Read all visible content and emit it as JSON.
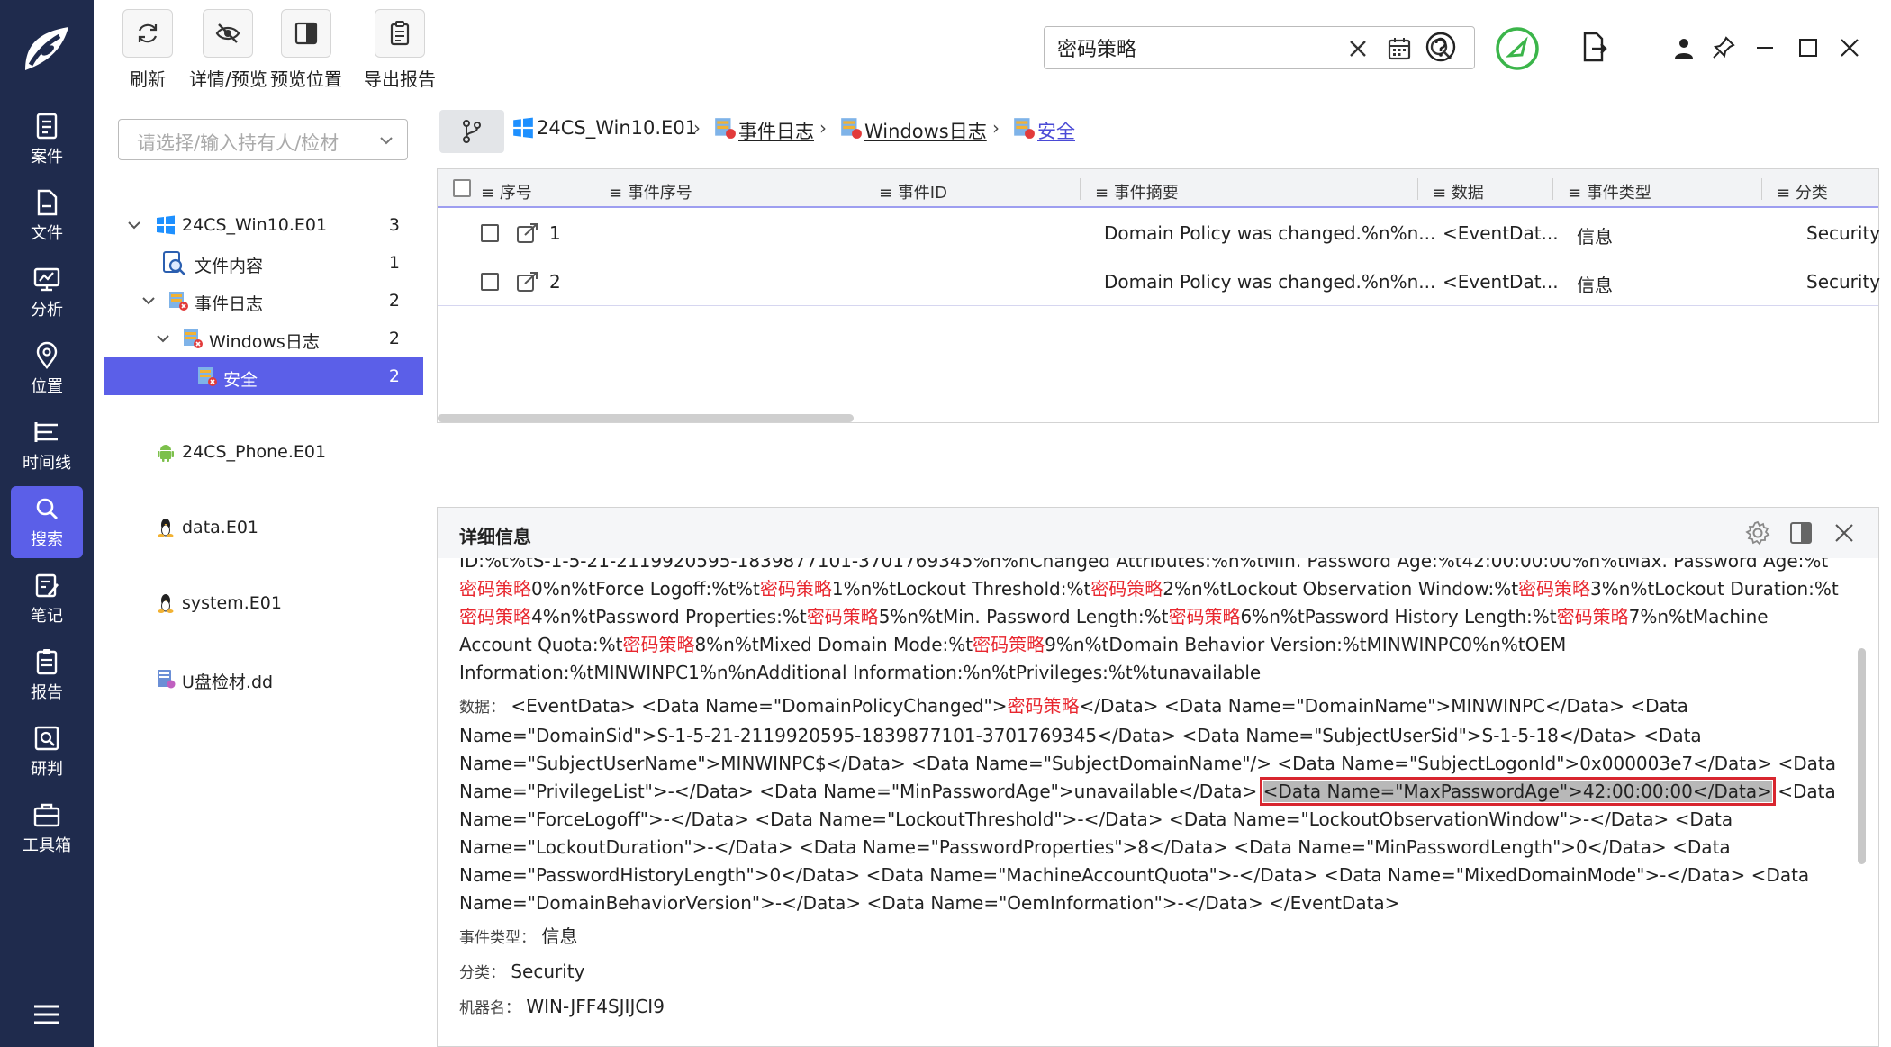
{
  "toolbar": {
    "refresh_label": "刷新",
    "detail_preview_label": "详情/预览",
    "preview_position_label": "预览位置",
    "export_report_label": "导出报告"
  },
  "search": {
    "value": "密码策略"
  },
  "nav": {
    "items": [
      {
        "label": "案件",
        "icon": "case-icon"
      },
      {
        "label": "文件",
        "icon": "file-icon"
      },
      {
        "label": "分析",
        "icon": "analysis-icon"
      },
      {
        "label": "位置",
        "icon": "location-icon"
      },
      {
        "label": "时间线",
        "icon": "timeline-icon"
      },
      {
        "label": "搜索",
        "icon": "search-icon",
        "active": true
      },
      {
        "label": "笔记",
        "icon": "note-icon"
      },
      {
        "label": "报告",
        "icon": "report-icon"
      },
      {
        "label": "研判",
        "icon": "judge-icon"
      },
      {
        "label": "工具箱",
        "icon": "toolbox-icon"
      }
    ]
  },
  "left": {
    "select_placeholder": "请选择/输入持有人/检材",
    "tree": [
      {
        "label": "24CS_Win10.E01",
        "count": "3"
      },
      {
        "label": "文件内容",
        "count": "1"
      },
      {
        "label": "事件日志",
        "count": "2"
      },
      {
        "label": "Windows日志",
        "count": "2"
      },
      {
        "label": "安全",
        "count": "2"
      },
      {
        "label": "24CS_Phone.E01",
        "count": ""
      },
      {
        "label": "data.E01",
        "count": ""
      },
      {
        "label": "system.E01",
        "count": ""
      },
      {
        "label": "U盘检材.dd",
        "count": ""
      }
    ]
  },
  "breadcrumb": [
    "24CS_Win10.E01",
    "事件日志",
    "Windows日志",
    "安全"
  ],
  "table": {
    "columns": [
      "序号",
      "事件序号",
      "事件ID",
      "事件摘要",
      "数据",
      "事件类型",
      "分类"
    ],
    "rows": [
      {
        "index": "1",
        "summary": "Domain Policy was changed.%n%n...",
        "data": "<EventDat...",
        "type": "信息",
        "category": "Security"
      },
      {
        "index": "2",
        "summary": "Domain Policy was changed.%n%n...",
        "data": "<EventDat...",
        "type": "信息",
        "category": "Security"
      }
    ]
  },
  "detail": {
    "title": "详细信息",
    "keyword": "密码策略",
    "line1": "ID:%t%tS-1-5-21-2119920595-1839877101-3701769345%n%nChanged Attributes:%n%tMin. Password Age:%t42:00:00:00%n%tMax. Password Age:%t",
    "s1": "0%n%tForce Logoff:%t%t",
    "s2": "1%n%tLockout Threshold:%t",
    "s3": "2%n%tLockout Observation Window:%t",
    "s4": "3%n%tLockout Duration:%t",
    "s5": "4%n%tPassword Properties:%t",
    "s6": "5%n%tMin. Password Length:%t",
    "s7": "6%n%tPassword History Length:%t",
    "s8": "7%n%tMachine Account Quota:%t",
    "s9": "8%n%tMixed Domain Mode:%t",
    "s10": "9%n%tDomain Behavior Version:%tMINWINPC0%n%tOEM Information:%tMINWINPC1%n%nAdditional Information:%n%tPrivileges:%t%tunavailable",
    "data_label": "数据：",
    "data_a": "<EventData> <Data Name=\"DomainPolicyChanged\">",
    "data_b": "</Data> <Data Name=\"DomainName\">MINWINPC</Data> <Data Name=\"DomainSid\">S-1-5-21-2119920595-1839877101-3701769345</Data> <Data Name=\"SubjectUserSid\">S-1-5-18</Data> <Data Name=\"SubjectUserName\">MINWINPC$</Data> <Data Name=\"SubjectDomainName\"/> <Data Name=\"SubjectLogonId\">0x000003e7</Data> <Data Name=\"PrivilegeList\">-</Data> <Data Name=\"MinPasswordAge\">unavailable</Data>",
    "data_hl": "<Data Name=\"MaxPasswordAge\">42:00:00:00</Data>",
    "data_c": " <Data Name=\"ForceLogoff\">-</Data> <Data Name=\"LockoutThreshold\">-</Data> <Data Name=\"LockoutObservationWindow\">-</Data> <Data Name=\"LockoutDuration\">-</Data> <Data Name=\"PasswordProperties\">8</Data> <Data Name=\"MinPasswordLength\">0</Data> <Data Name=\"PasswordHistoryLength\">0</Data> <Data Name=\"MachineAccountQuota\">-</Data> <Data Name=\"MixedDomainMode\">-</Data> <Data Name=\"DomainBehaviorVersion\">-</Data> <Data Name=\"OemInformation\">-</Data> </EventData>",
    "type_label": "事件类型：",
    "type_value": "信息",
    "category_label": "分类：",
    "category_value": "Security",
    "machine_label": "机器名：",
    "machine_value": "WIN-JFF4SJIJCI9"
  },
  "colors": {
    "nav_bg": "#1f2b4d",
    "accent": "#5b5fe8",
    "keyword": "#e8262e",
    "highlight_border": "#d8262f"
  }
}
